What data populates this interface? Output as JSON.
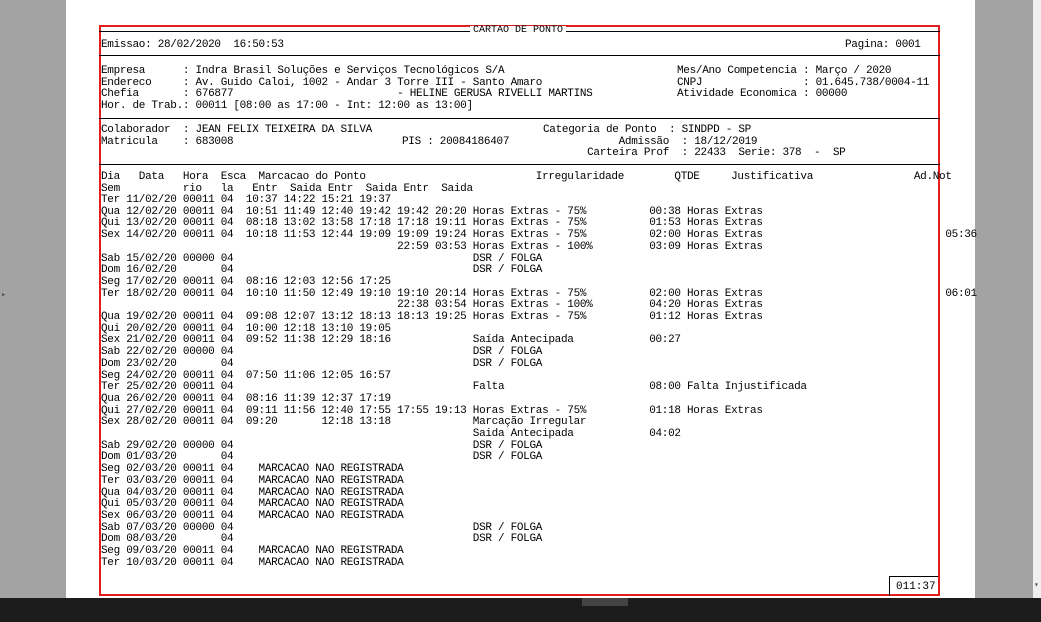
{
  "report": {
    "title": "CARTAO DE PONTO",
    "emissao": "Emissao: 28/02/2020  16:50:53",
    "pagina": "Pagina: 0001",
    "company": [
      "Empresa      : Indra Brasil Soluções e Serviços Tecnológicos S/A",
      "Endereco     : Av. Guido Caloi, 1002 - Andar 3 Torre III - Santo Amaro",
      "Chefia       : 676877                          - HELINE GERUSA RIVELLI MARTINS",
      "Hor. de Trab.: 00011 [08:00 as 17:00 - Int: 12:00 as 13:00]"
    ],
    "company_right": [
      "Mes/Ano Competencia : Março / 2020",
      "CNPJ                : 01.645.738/0004-11",
      "Atividade Economica : 00000"
    ],
    "employee_left": [
      "Colaborador  : JEAN FELIX TEIXEIRA DA SILVA",
      "Matricula    : 683008"
    ],
    "pis": "PIS : 20084186407",
    "employee_right": [
      "Categoria de Ponto  : SINDPD - SP",
      "            Admissão  : 18/12/2019",
      "       Carteira Prof  : 22433  Serie: 378  -  SP"
    ],
    "header_lines": [
      "Dia   Data   Hora  Esca  Marcacao do Ponto                           Irregularidade        QTDE     Justificativa                Ad.Not",
      "Sem          rio   la   Entr  Saida Entr  Saida Entr  Saida"
    ],
    "rows": [
      "Ter 11/02/20 00011 04  10:37 14:22 15:21 19:37",
      "Qua 12/02/20 00011 04  10:51 11:49 12:40 19:42 19:42 20:20 Horas Extras - 75%          00:38 Horas Extras",
      "Qui 13/02/20 00011 04  08:18 13:02 13:58 17:18 17:18 19:11 Horas Extras - 75%          01:53 Horas Extras",
      "Sex 14/02/20 00011 04  10:18 11:53 12:44 19:09 19:09 19:24 Horas Extras - 75%          02:00 Horas Extras                             05:36",
      "                                               22:59 03:53 Horas Extras - 100%         03:09 Horas Extras",
      "Sab 15/02/20 00000 04                                      DSR / FOLGA",
      "Dom 16/02/20       04                                      DSR / FOLGA",
      "Seg 17/02/20 00011 04  08:16 12:03 12:56 17:25",
      "Ter 18/02/20 00011 04  10:10 11:50 12:49 19:10 19:10 20:14 Horas Extras - 75%          02:00 Horas Extras                             06:01",
      "                                               22:38 03:54 Horas Extras - 100%         04:20 Horas Extras",
      "Qua 19/02/20 00011 04  09:08 12:07 13:12 18:13 18:13 19:25 Horas Extras - 75%          01:12 Horas Extras",
      "Qui 20/02/20 00011 04  10:00 12:18 13:10 19:05",
      "Sex 21/02/20 00011 04  09:52 11:38 12:29 18:16             Saída Antecipada            00:27",
      "Sab 22/02/20 00000 04                                      DSR / FOLGA",
      "Dom 23/02/20       04                                      DSR / FOLGA",
      "Seg 24/02/20 00011 04  07:50 11:06 12:05 16:57",
      "Ter 25/02/20 00011 04                                      Falta                       08:00 Falta Injustificada",
      "Qua 26/02/20 00011 04  08:16 11:39 12:37 17:19",
      "Qui 27/02/20 00011 04  09:11 11:56 12:40 17:55 17:55 19:13 Horas Extras - 75%          01:18 Horas Extras",
      "Sex 28/02/20 00011 04  09:20       12:18 13:18             Marcação Irregular",
      "                                                           Saida Antecipada            04:02",
      "Sab 29/02/20 00000 04                                      DSR / FOLGA",
      "Dom 01/03/20       04                                      DSR / FOLGA",
      "Seg 02/03/20 00011 04    MARCACAO NAO REGISTRADA",
      "Ter 03/03/20 00011 04    MARCACAO NAO REGISTRADA",
      "Qua 04/03/20 00011 04    MARCACAO NAO REGISTRADA",
      "Qui 05/03/20 00011 04    MARCACAO NAO REGISTRADA",
      "Sex 06/03/20 00011 04    MARCACAO NAO REGISTRADA",
      "Sab 07/03/20 00000 04                                      DSR / FOLGA",
      "Dom 08/03/20       04                                      DSR / FOLGA",
      "Seg 09/03/20 00011 04    MARCACAO NAO REGISTRADA",
      "Ter 10/03/20 00011 04    MARCACAO NAO REGISTRADA"
    ],
    "total": "011:37"
  }
}
